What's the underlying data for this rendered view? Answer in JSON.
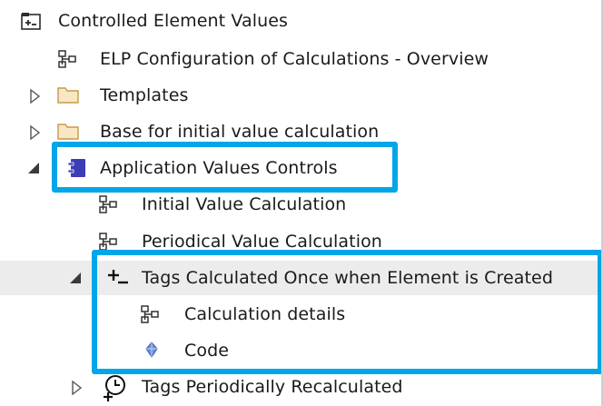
{
  "tree": {
    "root": {
      "label": "Controlled Element Values",
      "icon": "package-folder-icon"
    },
    "items": [
      {
        "label": "ELP Configuration of Calculations - Overview",
        "icon": "diagram-icon"
      },
      {
        "label": "Templates",
        "icon": "folder-icon",
        "expander": "collapsed"
      },
      {
        "label": "Base for initial value calculation",
        "icon": "folder-icon",
        "expander": "collapsed"
      },
      {
        "label": "Application Values Controls",
        "icon": "component-icon",
        "expander": "expanded"
      },
      {
        "label": "Initial Value Calculation",
        "icon": "diagram-icon"
      },
      {
        "label": "Periodical Value Calculation",
        "icon": "diagram-icon"
      },
      {
        "label": "Tags Calculated Once when Element is Created",
        "icon": "plus-activity-icon",
        "expander": "expanded"
      },
      {
        "label": "Calculation details",
        "icon": "diagram-icon"
      },
      {
        "label": "Code",
        "icon": "code-gem-icon"
      },
      {
        "label": "Tags Periodically Recalculated",
        "icon": "timer-event-icon",
        "expander": "collapsed"
      }
    ]
  },
  "colors": {
    "highlight": "#00a6e8",
    "selected_row": "#ececec",
    "component_icon": "#3d3db8",
    "folder": "#e8c98a"
  }
}
